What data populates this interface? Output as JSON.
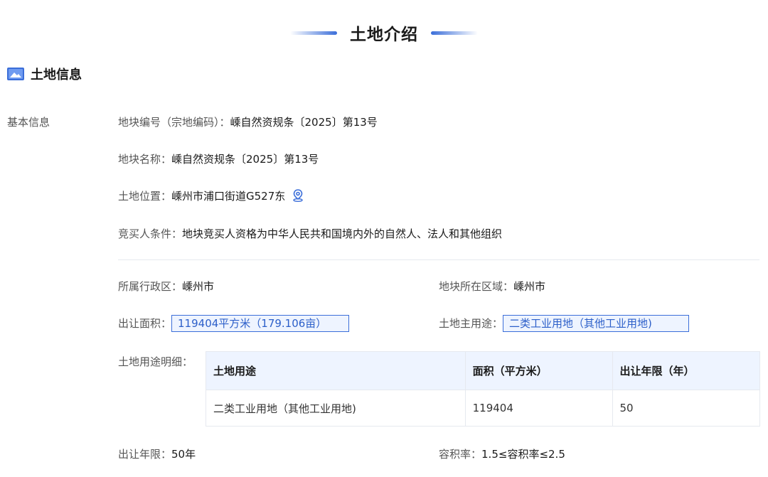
{
  "section": {
    "title": "土地介绍"
  },
  "sub_heading": {
    "title": "土地信息",
    "icon": "image-icon"
  },
  "basic_info": {
    "group_label": "基本信息",
    "parcel_code_label": "地块编号（宗地编码）：",
    "parcel_code_value": "嵊自然资规条〔2025〕第13号",
    "parcel_name_label": "地块名称：",
    "parcel_name_value": "嵊自然资规条〔2025〕第13号",
    "location_label": "土地位置：",
    "location_value": "嵊州市浦口街道G527东",
    "location_icon": "map-pin-icon",
    "bidder_label": "竞买人条件：",
    "bidder_value": "地块竞买人资格为中华人民共和国境内外的自然人、法人和其他组织"
  },
  "details": {
    "district_label": "所属行政区：",
    "district_value": "嵊州市",
    "region_label": "地块所在区域：",
    "region_value": "嵊州市",
    "area_label": "出让面积：",
    "area_value": "119404平方米（179.106亩）",
    "use_label": "土地主用途：",
    "use_value": "二类工业用地（其他工业用地)",
    "use_detail_label": "土地用途明细：",
    "term_label": "出让年限：",
    "term_value": "50年",
    "far_label": "容积率：",
    "far_value": "1.5≤容积率≤2.5"
  },
  "use_table": {
    "headers": [
      "土地用途",
      "面积（平方米）",
      "出让年限（年）"
    ],
    "rows": [
      [
        "二类工业用地（其他工业用地)",
        "119404",
        "50"
      ]
    ]
  },
  "colors": {
    "accent": "#3b6ed9",
    "highlight_bg": "#eef4ff"
  }
}
